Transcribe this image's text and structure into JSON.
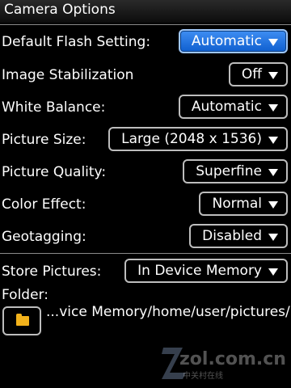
{
  "title": "Camera Options",
  "settings": [
    {
      "label": "Default Flash Setting:",
      "value": "Automatic"
    },
    {
      "label": "Image Stabilization",
      "value": "Off"
    },
    {
      "label": "White Balance:",
      "value": "Automatic"
    },
    {
      "label": "Picture Size:",
      "value": "Large (2048 x 1536)"
    },
    {
      "label": "Picture Quality:",
      "value": "Superfine"
    },
    {
      "label": "Color Effect:",
      "value": "Normal"
    },
    {
      "label": "Geotagging:",
      "value": "Disabled"
    }
  ],
  "store": {
    "label": "Store Pictures:",
    "value": "In Device Memory"
  },
  "folder": {
    "label": "Folder:",
    "path": "...vice Memory/home/user/pictures/"
  },
  "watermark": {
    "text": "zol.com.cn",
    "sub": "中关村在线"
  },
  "colors": {
    "accent": "#2f7fe6",
    "folder_icon": "#f2b21b"
  }
}
